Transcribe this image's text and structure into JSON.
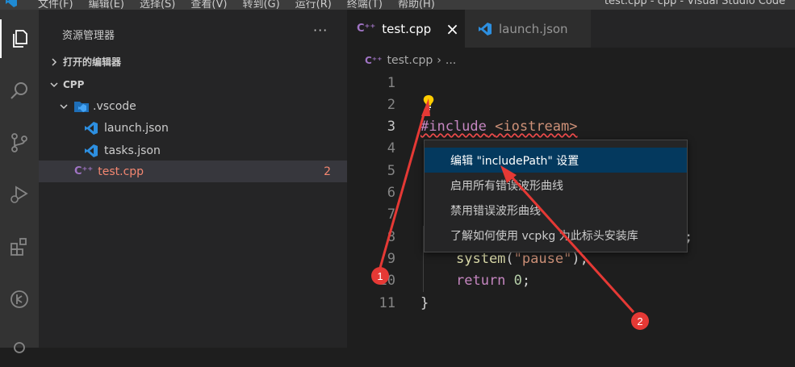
{
  "titlebar": {
    "menu": [
      "文件(F)",
      "编辑(E)",
      "选择(S)",
      "查看(V)",
      "转到(G)",
      "运行(R)",
      "终端(T)",
      "帮助(H)"
    ],
    "window_title": "test.cpp - cpp - Visual Studio Code"
  },
  "activitybar": {
    "items": [
      "explorer-icon",
      "search-icon",
      "source-control-icon",
      "run-debug-icon",
      "extensions-icon",
      "remote-icon",
      "account-icon"
    ]
  },
  "sidebar": {
    "title": "资源管理器",
    "more": "···",
    "open_editors": "打开的编辑器",
    "folder": "CPP",
    "vscode_folder": ".vscode",
    "files": [
      {
        "name": "launch.json"
      },
      {
        "name": "tasks.json"
      }
    ],
    "test_file": "test.cpp",
    "test_badge": "2"
  },
  "tabs": [
    {
      "label": "test.cpp",
      "close": "×"
    },
    {
      "label": "launch.json"
    }
  ],
  "breadcrumb": {
    "file": "test.cpp",
    "sep": "›",
    "rest": "..."
  },
  "code": {
    "line_numbers": [
      "1",
      "2",
      "3",
      "4",
      "5",
      "6",
      "7",
      "8",
      "9",
      "10",
      "11"
    ],
    "line3_pp": "#include",
    "line3_hdr": "<iostream>",
    "line8_tail": ";",
    "line9_fn": "system",
    "line9_open": "(",
    "line9_str": "\"pause\"",
    "line9_close": ");",
    "line10_kw": "return",
    "line10_num": "0",
    "line10_semi": ";",
    "line11": "}"
  },
  "context_menu": {
    "items": [
      "编辑 \"includePath\" 设置",
      "启用所有错误波形曲线",
      "禁用错误波形曲线",
      "了解如何使用 vcpkg 为此标头安装库"
    ]
  },
  "annotations": {
    "badge1": "1",
    "badge2": "2",
    "color": "#e53935"
  }
}
